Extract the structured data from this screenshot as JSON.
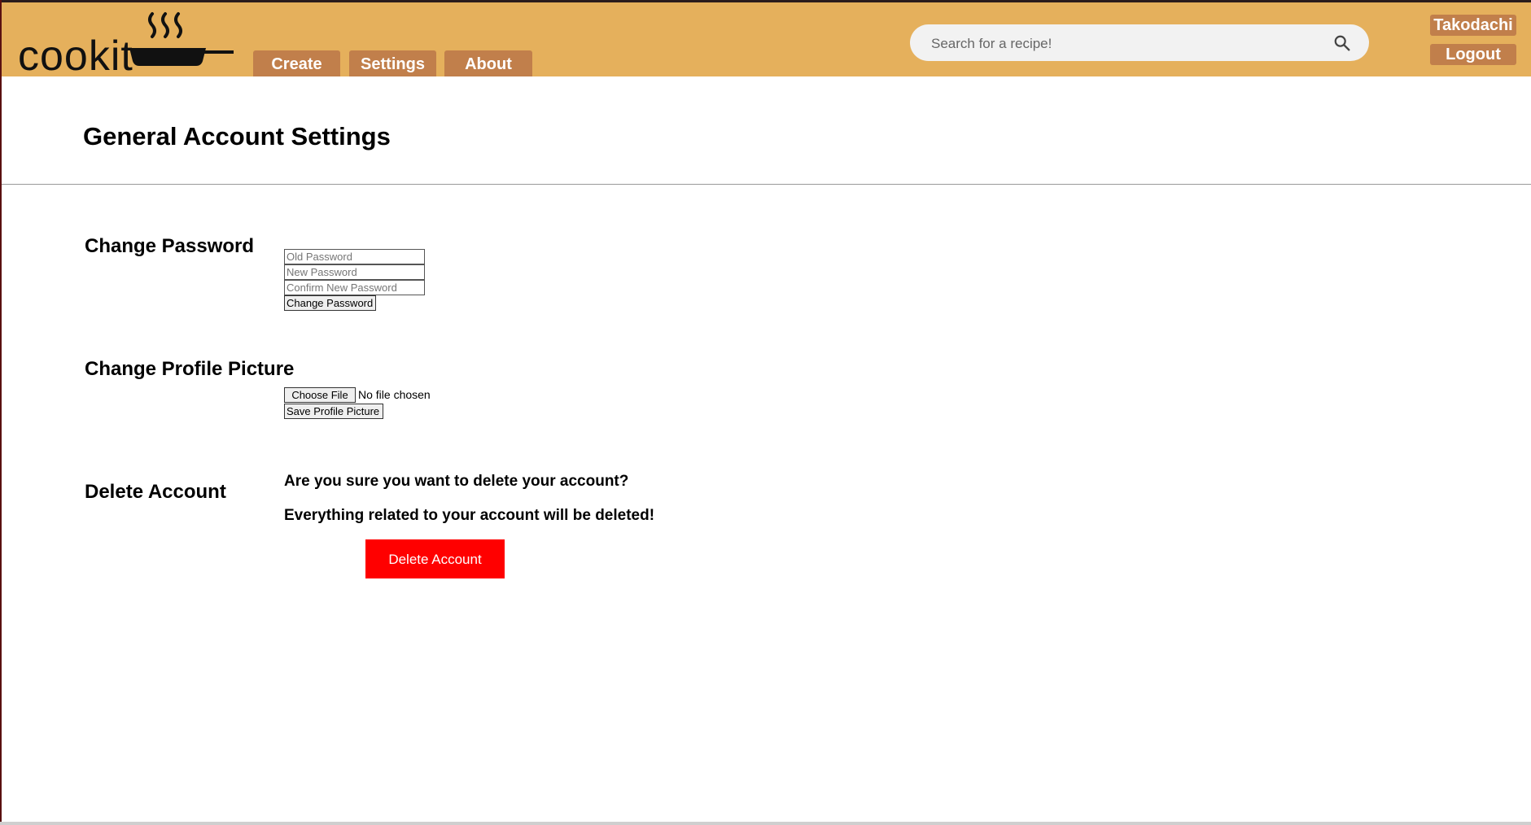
{
  "header": {
    "logo_text": "cookit",
    "nav": [
      {
        "label": "Create"
      },
      {
        "label": "Settings"
      },
      {
        "label": "About"
      }
    ],
    "search": {
      "placeholder": "Search for a recipe!"
    },
    "user": {
      "username": "Takodachi",
      "logout_label": "Logout"
    }
  },
  "page": {
    "title": "General Account Settings"
  },
  "change_password": {
    "label": "Change Password",
    "old_placeholder": "Old Password",
    "new_placeholder": "New Password",
    "confirm_placeholder": "Confirm New Password",
    "submit_label": "Change Password"
  },
  "profile_picture": {
    "label": "Change Profile Picture",
    "choose_label": "Choose File",
    "file_status": "No file chosen",
    "save_label": "Save Profile Picture"
  },
  "delete_account": {
    "label": "Delete Account",
    "question": "Are you sure you want to delete your account?",
    "warning": "Everything related to your account will be deleted!",
    "button_label": "Delete Account"
  },
  "colors": {
    "header_bg": "#e5b05c",
    "tab_bg": "#c17f4b",
    "danger": "#ff0000"
  }
}
